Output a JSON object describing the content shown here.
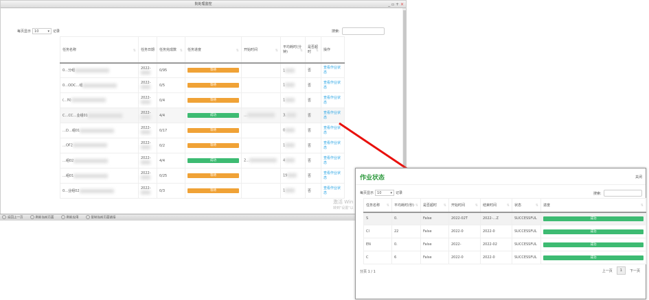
{
  "window": {
    "title": "批处理监控",
    "controls": [
      "_",
      "▫",
      "+",
      "×"
    ]
  },
  "list": {
    "length_prefix": "每页显示",
    "length_value": "10",
    "length_suffix": "记录",
    "search_label": "搜索:"
  },
  "table": {
    "headers": [
      "任务名称",
      "任务日期",
      "任务完成数",
      "任务进度",
      "开始时间",
      "平均耗时(分钟)",
      "是否超时",
      "操作"
    ],
    "rows": [
      {
        "name": "0…分组",
        "date": "2022-",
        "done": "0/95",
        "status": "等待",
        "state": "wait",
        "start": "",
        "avg": "1",
        "timeout": "否",
        "action": "查看作业状态"
      },
      {
        "name": "0…ODC…组",
        "date": "2022-",
        "done": "0/5",
        "status": "等待",
        "state": "wait",
        "start": "",
        "avg": "1",
        "timeout": "否",
        "action": "查看作业状态"
      },
      {
        "name": "(…N)",
        "date": "2022-",
        "done": "0/4",
        "status": "等待",
        "state": "wait",
        "start": "",
        "avg": "1",
        "timeout": "否",
        "action": "查看作业状态"
      },
      {
        "name": "C…CC…业组01",
        "date": "2022-",
        "done": "4/4",
        "status": "成功",
        "state": "ok",
        "start": "…",
        "avg": "3.",
        "timeout": "否",
        "action": "查看作业状态"
      },
      {
        "name": "…D…组01",
        "date": "2022-",
        "done": "0/17",
        "status": "等待",
        "state": "wait",
        "start": "",
        "avg": "0",
        "timeout": "否",
        "action": "查看作业状态"
      },
      {
        "name": "…OF2",
        "date": "2022-",
        "done": "0/2",
        "status": "等待",
        "state": "wait",
        "start": "",
        "avg": "1",
        "timeout": "否",
        "action": "查看作业状态"
      },
      {
        "name": "…组02",
        "date": "2022-",
        "done": "4/4",
        "status": "成功",
        "state": "ok",
        "start": "2…",
        "avg": "4",
        "timeout": "否",
        "action": "查看作业状态"
      },
      {
        "name": "…组01",
        "date": "2022-",
        "done": "0/25",
        "status": "等待",
        "state": "wait",
        "start": "",
        "avg": "19",
        "timeout": "否",
        "action": "查看作业状态"
      },
      {
        "name": "0…业组02",
        "date": "2022-",
        "done": "0/3",
        "status": "等待",
        "state": "wait",
        "start": "",
        "avg": "1",
        "timeout": "否",
        "action": "查看作业状态"
      }
    ]
  },
  "watermark": {
    "line1": "激活 Win",
    "line2": "转到\"设置\"以"
  },
  "bottombar": [
    "返回上一页",
    "刷新当前页面",
    "刷新应用",
    "复制当前页面链接"
  ],
  "modal": {
    "title": "作业状态",
    "close": "关闭",
    "length_prefix": "每页显示",
    "length_value": "10",
    "length_suffix": "记录",
    "search_label": "搜索:",
    "headers": [
      "任务名称",
      "平均耗时(秒)",
      "是否超时",
      "开始时间",
      "结束时间",
      "状态",
      "进度"
    ],
    "rows": [
      {
        "name": "S",
        "avg": "0.",
        "timeout": "False",
        "start": "2022-02T",
        "end": "2022-…Z",
        "state": "SUCCESSFUL",
        "progress": "成功"
      },
      {
        "name": "Cl",
        "avg": "22",
        "timeout": "False",
        "start": "2022-0",
        "end": "2022-0",
        "state": "SUCCESSFUL",
        "progress": "成功"
      },
      {
        "name": "EN",
        "avg": "0.",
        "timeout": "False",
        "start": "2022-",
        "end": "2022-02",
        "state": "SUCCESSFUL",
        "progress": "成功"
      },
      {
        "name": "C",
        "avg": "6",
        "timeout": "False",
        "start": "2022-0",
        "end": "2022-0",
        "state": "SUCCESSFUL",
        "progress": "成功"
      }
    ],
    "info": "分页 1 / 1",
    "prev": "上一页",
    "page": "1",
    "next": "下一页"
  },
  "colors": {
    "wait": "#f0a236",
    "success": "#3dbb72",
    "link": "#2aa5e5",
    "modal_title": "#2f9a3f",
    "arrow": "#e8100c"
  }
}
